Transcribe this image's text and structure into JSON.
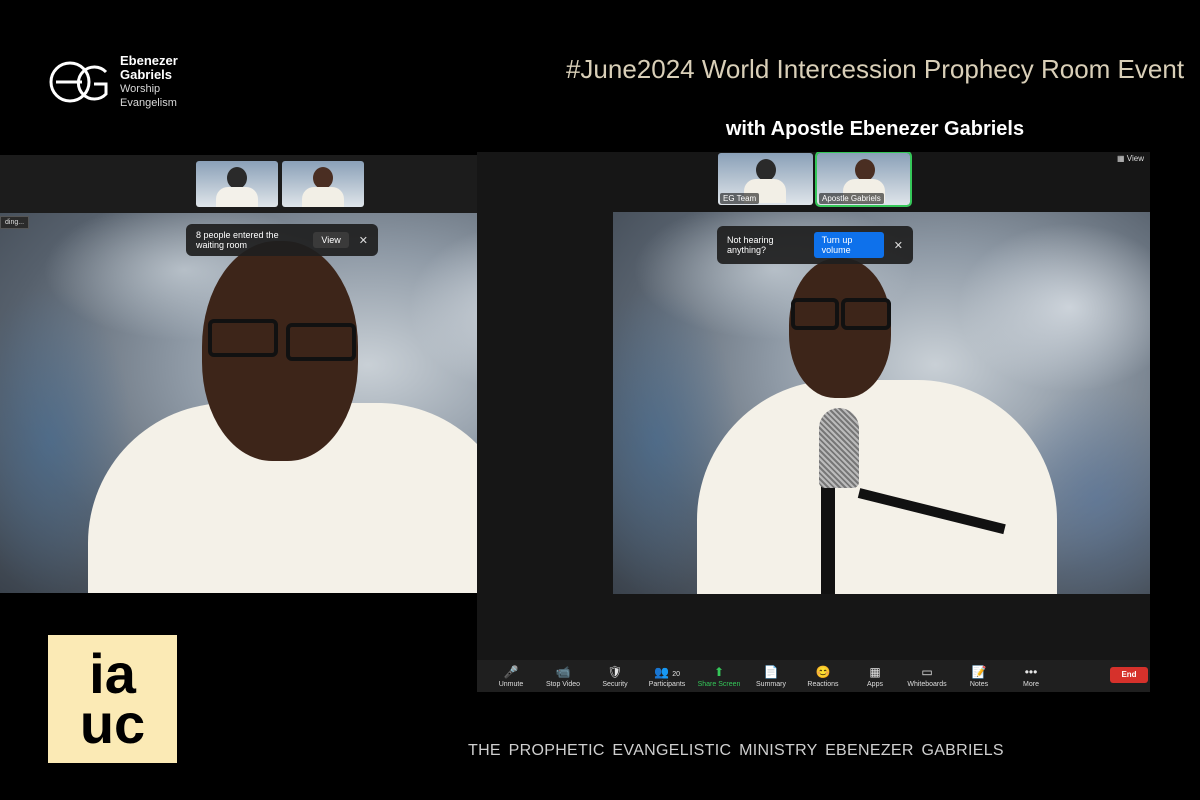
{
  "brand": {
    "line1": "Ebenezer",
    "line2": "Gabriels",
    "line3": "Worship",
    "line4": "Evangelism"
  },
  "event": {
    "title": "#June2024 World Intercession Prophecy Room Event",
    "subtitle": "with Apostle Ebenezer Gabriels"
  },
  "left_panel": {
    "recording_label": "ding...",
    "toast": {
      "text": "8 people entered the waiting room",
      "button": "View",
      "close": "✕"
    }
  },
  "right_panel": {
    "view_label": "View",
    "thumbs": [
      {
        "label": "EG Team"
      },
      {
        "label": "Apostle Gabriels"
      }
    ],
    "toast": {
      "text": "Not hearing anything?",
      "button": "Turn up volume",
      "close": "✕"
    },
    "toolbar": [
      {
        "icon": "🎤",
        "label": "Unmute"
      },
      {
        "icon": "📹",
        "label": "Stop Video"
      },
      {
        "icon": "🛡",
        "label": "Security"
      },
      {
        "icon": "👥",
        "label": "Participants",
        "count": "20"
      },
      {
        "icon": "⬆",
        "label": "Share Screen"
      },
      {
        "icon": "📄",
        "label": "Summary"
      },
      {
        "icon": "😊",
        "label": "Reactions"
      },
      {
        "icon": "▦",
        "label": "Apps"
      },
      {
        "icon": "▭",
        "label": "Whiteboards"
      },
      {
        "icon": "📝",
        "label": "Notes"
      },
      {
        "icon": "•••",
        "label": "More"
      }
    ],
    "end_label": "End"
  },
  "footer": {
    "logo_line1": "ia",
    "logo_line2": "uc",
    "ministry": "THE  PROPHETIC EVANGELISTIC  MINISTRY  EBENEZER GABRIELS"
  },
  "colors": {
    "accent_green": "#35c759",
    "end_red": "#d6312b",
    "logo_bg": "#fbeab5"
  }
}
